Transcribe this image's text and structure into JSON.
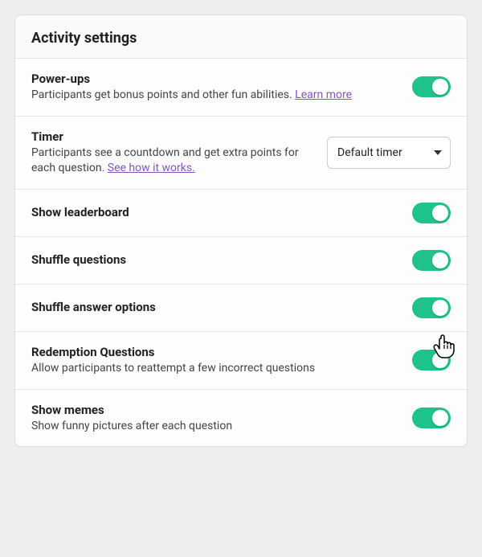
{
  "panelTitle": "Activity settings",
  "rows": {
    "powerUps": {
      "title": "Power-ups",
      "desc": "Participants get bonus points and other fun abilities.",
      "link": "Learn more"
    },
    "timer": {
      "title": "Timer",
      "descPrefix": "Participants see a countdown and get extra points for each question. ",
      "link": "See how it works.",
      "selectValue": "Default timer"
    },
    "leaderboard": {
      "title": "Show leaderboard"
    },
    "shuffleQuestions": {
      "title": "Shuffle questions"
    },
    "shuffleAnswers": {
      "title": "Shuffle answer options"
    },
    "redemption": {
      "title": "Redemption Questions",
      "desc": "Allow participants to reattempt a few incorrect questions"
    },
    "memes": {
      "title": "Show memes",
      "desc": "Show funny pictures after each question"
    }
  },
  "colors": {
    "toggleOn": "#1fc28b",
    "link": "#8854c0"
  }
}
